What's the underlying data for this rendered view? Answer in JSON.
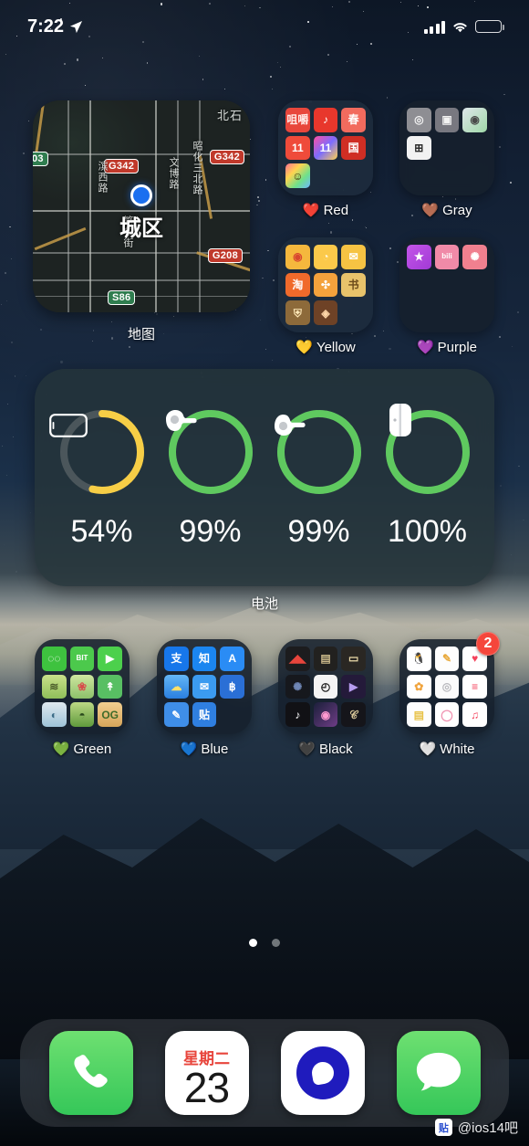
{
  "status_bar": {
    "time": "7:22",
    "location_icon": "location-arrow-icon",
    "signal_icon": "cellular-bars-icon",
    "wifi_icon": "wifi-icon",
    "battery_icon": "battery-icon",
    "battery_level_pct": 54,
    "battery_color": "#f8cf3f"
  },
  "map_widget": {
    "label": "地图",
    "city": "城区",
    "shields": [
      {
        "name": "G342",
        "color": "#c0392b"
      },
      {
        "name": "G342",
        "color": "#c0392b"
      },
      {
        "name": "G208",
        "color": "#c0392b"
      },
      {
        "name": "S86",
        "color": "#2f7d4f"
      },
      {
        "name": "03",
        "color": "#2f7d4f"
      }
    ],
    "street_labels": [
      "滨西路",
      "文博路",
      "昭化三北路",
      "北石",
      "繁华街"
    ],
    "user_location_icon": "blue-location-dot-icon"
  },
  "folders": [
    {
      "name": "Red",
      "emoji": "❤️",
      "emoji_name": "red-heart-emoji",
      "badge": null,
      "icons": [
        {
          "name": "red-text-app-icon",
          "label": "咀嚼",
          "bg": "#e8473c",
          "fg": "#ffe9e6"
        },
        {
          "name": "netease-music-icon",
          "label": "♪",
          "bg": "#e8372c",
          "fg": "#ffffff"
        },
        {
          "name": "red-gift-app-icon",
          "label": "春",
          "bg": "#f26b5e",
          "fg": "#ffffff"
        },
        {
          "name": "taobao-red-icon",
          "label": "11",
          "bg": "#ef4b3a",
          "fg": "#ffffff"
        },
        {
          "name": "rainbow-eleven-icon",
          "label": "11",
          "bg": "linear-gradient(135deg,#ff4fa3,#7b6bff,#ffd24f)",
          "fg": "#ffffff"
        },
        {
          "name": "guo-app-icon",
          "label": "国",
          "bg": "#cf2e24",
          "fg": "#ffffff"
        },
        {
          "name": "rainbow-emoji-app-icon",
          "label": "☺",
          "bg": "linear-gradient(135deg,#ff6f91,#ffd34f,#6fe08a,#6fb7ff)",
          "fg": "#3a2d00"
        }
      ]
    },
    {
      "name": "Gray",
      "emoji": "🤎",
      "emoji_name": "brown-heart-emoji",
      "badge": null,
      "icons": [
        {
          "name": "compass-app-icon",
          "label": "◎",
          "bg": "#8e8e93",
          "fg": "#f2f2f2"
        },
        {
          "name": "camera-app-icon",
          "label": "▣",
          "bg": "#787880",
          "fg": "#f2f2f2"
        },
        {
          "name": "find-my-app-icon",
          "label": "◉",
          "bg": "linear-gradient(135deg,#dfe6ea,#9fd8a8)",
          "fg": "#4a4a4a"
        },
        {
          "name": "calculator-app-icon",
          "label": "⊞",
          "bg": "#f2f2f2",
          "fg": "#2b2b2b"
        }
      ]
    },
    {
      "name": "Yellow",
      "emoji": "💛",
      "emoji_name": "yellow-heart-emoji",
      "badge": null,
      "icons": [
        {
          "name": "weibo-app-icon",
          "label": "◉",
          "bg": "#f5b83d",
          "fg": "#d8462f"
        },
        {
          "name": "idea-lamp-app-icon",
          "label": "◔",
          "bg": "#fbc94a",
          "fg": "#fff6d8"
        },
        {
          "name": "mail-yellow-app-icon",
          "label": "✉",
          "bg": "#f6c343",
          "fg": "#ffffff"
        },
        {
          "name": "taobao-app-icon",
          "label": "淘",
          "bg": "#f06a2b",
          "fg": "#ffffff"
        },
        {
          "name": "bird-game-app-icon",
          "label": "✣",
          "bg": "#f4a23c",
          "fg": "#ffffff"
        },
        {
          "name": "yellow-banner-app-icon",
          "label": "书",
          "bg": "#e8c36b",
          "fg": "#6b4a1a"
        },
        {
          "name": "strategy-game-app-icon",
          "label": "⛨",
          "bg": "#8d6a3a",
          "fg": "#ffe9b8"
        },
        {
          "name": "rpg-game-app-icon",
          "label": "◈",
          "bg": "#6e4226",
          "fg": "#ffd6a8"
        }
      ]
    },
    {
      "name": "Purple",
      "emoji": "💜",
      "emoji_name": "purple-heart-emoji",
      "badge": null,
      "icons": [
        {
          "name": "purple-star-app-icon",
          "label": "★",
          "bg": "linear-gradient(135deg,#c455e8,#a13ad6)",
          "fg": "#ffffff"
        },
        {
          "name": "bilibili-app-icon",
          "label": "bili",
          "bg": "#f08aa8",
          "fg": "#ffffff"
        },
        {
          "name": "pink-flower-app-icon",
          "label": "✺",
          "bg": "#f0808f",
          "fg": "#ffffff"
        }
      ]
    },
    {
      "name": "Green",
      "emoji": "💚",
      "emoji_name": "green-heart-emoji",
      "badge": null,
      "icons": [
        {
          "name": "wechat-app-icon",
          "label": "◌◌",
          "bg": "#3ec23f",
          "fg": "#ffffff"
        },
        {
          "name": "bit-app-icon",
          "label": "BIT",
          "bg": "#4cc94c",
          "fg": "#ffffff"
        },
        {
          "name": "facetime-app-icon",
          "label": "▶",
          "bg": "#4cd04c",
          "fg": "#ffffff"
        },
        {
          "name": "green-landscape-app-icon",
          "label": "≋",
          "bg": "linear-gradient(180deg,#c9e08a,#8fbf5a)",
          "fg": "#4b5c2a"
        },
        {
          "name": "mushroom-game-app-icon",
          "label": "❀",
          "bg": "linear-gradient(180deg,#cfe6a0,#8cc06a)",
          "fg": "#d84a4a"
        },
        {
          "name": "tree-app-icon",
          "label": "↟",
          "bg": "#58bf63",
          "fg": "#ffffff"
        },
        {
          "name": "health-green-app-icon",
          "label": "◐",
          "bg": "linear-gradient(180deg,#dfe9ef,#9ec3d8)",
          "fg": "#3b6b86"
        },
        {
          "name": "map-green-app-icon",
          "label": "◓",
          "bg": "linear-gradient(180deg,#bcd884,#5f9a3c)",
          "fg": "#2a4a1c"
        },
        {
          "name": "puzzle-game-app-icon",
          "label": "OG",
          "bg": "linear-gradient(180deg,#f2cf90,#d6a55a)",
          "fg": "#3f6b2a"
        }
      ]
    },
    {
      "name": "Blue",
      "emoji": "💙",
      "emoji_name": "blue-heart-emoji",
      "badge": null,
      "icons": [
        {
          "name": "alipay-app-icon",
          "label": "支",
          "bg": "#1777ea",
          "fg": "#ffffff"
        },
        {
          "name": "zhihu-app-icon",
          "label": "知",
          "bg": "#1b86f0",
          "fg": "#ffffff"
        },
        {
          "name": "app-store-icon",
          "label": "A",
          "bg": "#2a8cf5",
          "fg": "#ffffff"
        },
        {
          "name": "weather-app-icon",
          "label": "☁",
          "bg": "linear-gradient(180deg,#63b6f5,#2a7fe0)",
          "fg": "#ffe06a"
        },
        {
          "name": "mail-blue-app-icon",
          "label": "✉",
          "bg": "#3b9bf0",
          "fg": "#ffffff"
        },
        {
          "name": "baidu-app-icon",
          "label": "฿",
          "bg": "#2a6fd6",
          "fg": "#ffffff"
        },
        {
          "name": "notes-pen-app-icon",
          "label": "✎",
          "bg": "#3f8ee8",
          "fg": "#ffffff"
        },
        {
          "name": "tieba-app-icon",
          "label": "贴",
          "bg": "#2f7fe0",
          "fg": "#ffffff"
        }
      ]
    },
    {
      "name": "Black",
      "emoji": "🖤",
      "emoji_name": "black-heart-emoji",
      "badge": null,
      "icons": [
        {
          "name": "voice-memos-app-icon",
          "label": "◢◣",
          "bg": "#1c1c1e",
          "fg": "#e8453c"
        },
        {
          "name": "podcasts-dark-app-icon",
          "label": "▤",
          "bg": "#22211f",
          "fg": "#cbb98a"
        },
        {
          "name": "wallet-app-icon",
          "label": "▭",
          "bg": "#2a2723",
          "fg": "#e9d9a8"
        },
        {
          "name": "dark-sphere-app-icon",
          "label": "✺",
          "bg": "#16181d",
          "fg": "#6f86b5"
        },
        {
          "name": "clock-app-icon",
          "label": "◴",
          "bg": "#f4f4f4",
          "fg": "#1a1a1a"
        },
        {
          "name": "video-player-app-icon",
          "label": "▶",
          "bg": "#241a3a",
          "fg": "#b79cf0"
        },
        {
          "name": "douyin-app-icon",
          "label": "♪",
          "bg": "#111115",
          "fg": "#ffffff"
        },
        {
          "name": "siri-dark-app-icon",
          "label": "◉",
          "bg": "linear-gradient(135deg,#1b1f3a,#6e3d86)",
          "fg": "#ff9ad1"
        },
        {
          "name": "dark-circle-app-icon",
          "label": "𝒞",
          "bg": "#15151a",
          "fg": "#d9c89a"
        }
      ]
    },
    {
      "name": "White",
      "emoji": "🤍",
      "emoji_name": "white-heart-emoji",
      "badge": "2",
      "icons": [
        {
          "name": "qq-app-icon",
          "label": "🐧",
          "bg": "#ffffff",
          "fg": "#2b2b2b"
        },
        {
          "name": "keynote-app-icon",
          "label": "✎",
          "bg": "#fdfdfd",
          "fg": "#e8a93c"
        },
        {
          "name": "health-app-icon",
          "label": "♥",
          "bg": "#ffffff",
          "fg": "#f4425c"
        },
        {
          "name": "photos-app-icon",
          "label": "✿",
          "bg": "#ffffff",
          "fg": "#f0a33c"
        },
        {
          "name": "settings-ring-icon",
          "label": "◎",
          "bg": "#fbfbfb",
          "fg": "#b9b9bd"
        },
        {
          "name": "reminders-app-icon",
          "label": "≡",
          "bg": "#ffffff",
          "fg": "#f4425c"
        },
        {
          "name": "notes-app-icon",
          "label": "▤",
          "bg": "#fdfdfd",
          "fg": "#e8c247"
        },
        {
          "name": "pink-circle-app-icon",
          "label": "◯",
          "bg": "#ffffff",
          "fg": "#f090b0"
        },
        {
          "name": "music-app-icon",
          "label": "♫",
          "bg": "#ffffff",
          "fg": "#f4425c"
        }
      ]
    }
  ],
  "battery_widget": {
    "label": "电池",
    "items": [
      {
        "device": "iPhone",
        "icon": "iphone-icon",
        "value": "54%",
        "pct": 54,
        "ring_color": "#f7ce46"
      },
      {
        "device": "AirPod Left",
        "icon": "airpod-left-icon",
        "value": "99%",
        "pct": 99,
        "ring_color": "#5fc95f"
      },
      {
        "device": "AirPod Right",
        "icon": "airpod-right-icon",
        "value": "99%",
        "pct": 99,
        "ring_color": "#5fc95f"
      },
      {
        "device": "AirPods Case",
        "icon": "airpods-case-icon",
        "value": "100%",
        "pct": 100,
        "ring_color": "#5fc95f"
      }
    ],
    "track_color": "#4b565b"
  },
  "page_indicator": {
    "total": 2,
    "active_index": 0
  },
  "dock": {
    "items": [
      {
        "name": "phone-app-icon",
        "label": ""
      },
      {
        "name": "calendar-app-icon",
        "weekday": "星期二",
        "day": "23"
      },
      {
        "name": "browser-app-icon",
        "label": ""
      },
      {
        "name": "messages-app-icon",
        "label": ""
      }
    ]
  },
  "watermark": {
    "badge": "贴",
    "handle": "@ios14吧"
  }
}
